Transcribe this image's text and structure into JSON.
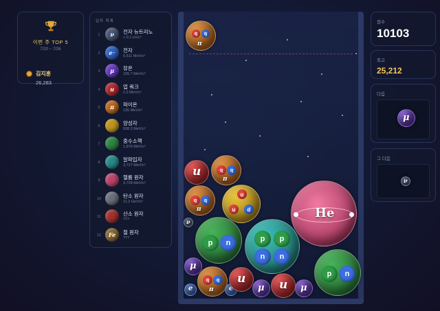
{
  "top5": {
    "title": "이번 주 TOP 5",
    "dates": "7/20 ~ 7/26",
    "leader_name": "김지훈",
    "leader_score": "26,283",
    "icon": "trophy-icon"
  },
  "particle_list": {
    "title": "입자 목록",
    "items": [
      {
        "num": "1",
        "name": "전자 뉴트리노",
        "mass": "< 0.1 eV/c²",
        "symbol": "ν",
        "color": "#4a5778"
      },
      {
        "num": "2",
        "name": "전자",
        "mass": "0.511 MeV/c²",
        "symbol": "e⁻",
        "color": "#2f64c8"
      },
      {
        "num": "3",
        "name": "뮤온",
        "mass": "105.7 MeV/c²",
        "symbol": "μ",
        "color": "#6a3bc6"
      },
      {
        "num": "4",
        "name": "업 쿼크",
        "mass": "2.2 MeV/c²",
        "symbol": "u",
        "color": "#b52a2e"
      },
      {
        "num": "5",
        "name": "파이온",
        "mass": "135 MeV/c²",
        "symbol": "π",
        "color": "#c16a1c"
      },
      {
        "num": "6",
        "name": "양성자",
        "mass": "938.3 MeV/c²",
        "symbol": "",
        "color": "#c79a1f"
      },
      {
        "num": "7",
        "name": "중수소핵",
        "mass": "1,876 MeV/c²",
        "symbol": "",
        "color": "#2f8a45"
      },
      {
        "num": "8",
        "name": "알파입자",
        "mass": "3,727 MeV/c²",
        "symbol": "",
        "color": "#2a8f8c"
      },
      {
        "num": "9",
        "name": "헬륨 원자",
        "mass": "3,728 MeV/c²",
        "symbol": "",
        "color": "#c2476f"
      },
      {
        "num": "10",
        "name": "탄소 원자",
        "mass": "11.2 GeV/c²",
        "symbol": "",
        "color": "#6f7380"
      },
      {
        "num": "11",
        "name": "산소 원자",
        "mass": "???",
        "symbol": "",
        "color": "#a8322e"
      },
      {
        "num": "12",
        "name": "철 원자",
        "mass": "???",
        "symbol": "Fe",
        "color": "#8a6a2c"
      }
    ]
  },
  "board": {
    "he_label": "He",
    "labels": {
      "nu": "ν",
      "e": "e",
      "mu": "μ",
      "u": "u",
      "pi": "π",
      "p": "p",
      "n": "n",
      "q": "q",
      "d": "d"
    }
  },
  "score": {
    "label": "점수",
    "value": "10103"
  },
  "best": {
    "label": "최고",
    "value": "25,212"
  },
  "next": {
    "label": "다음",
    "symbol": "μ",
    "color": "#6a3bc6"
  },
  "after": {
    "label": "그 다음",
    "symbol": "ν",
    "color": "#4a5778"
  }
}
